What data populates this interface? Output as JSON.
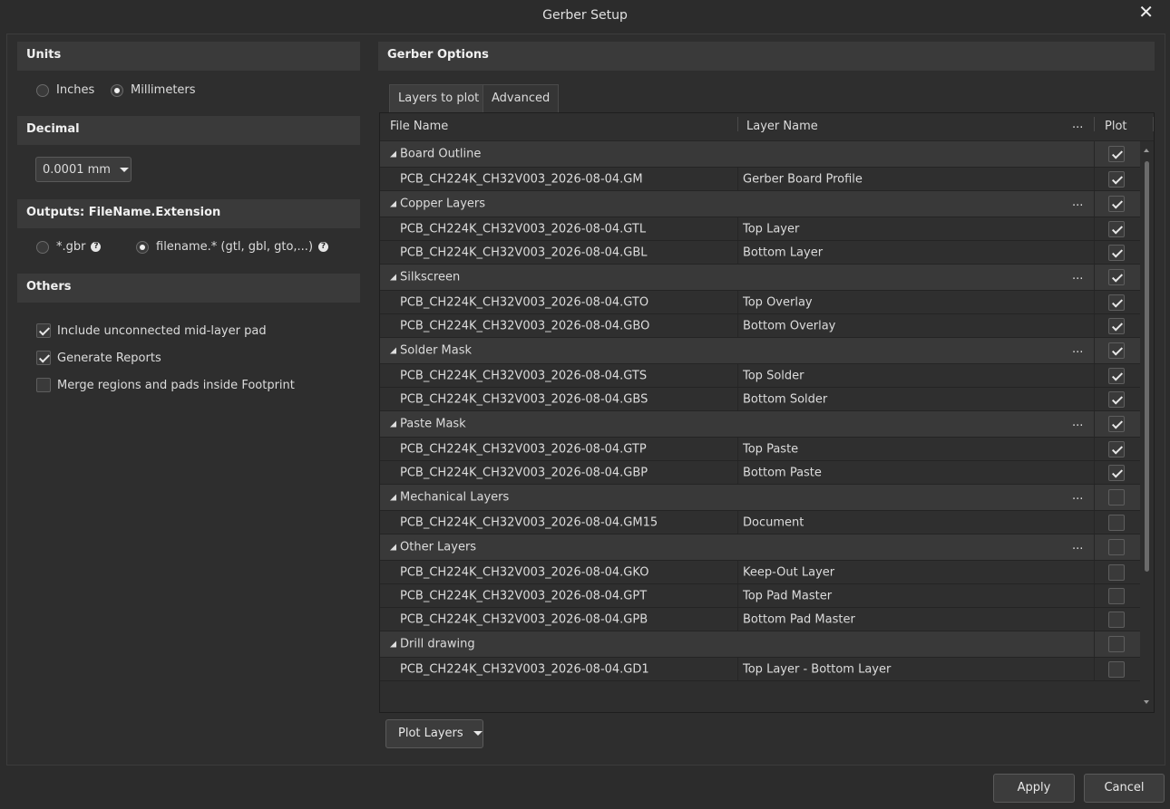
{
  "window": {
    "title": "Gerber Setup"
  },
  "units": {
    "header": "Units",
    "options": [
      "Inches",
      "Millimeters"
    ],
    "selected": "Millimeters"
  },
  "decimal": {
    "header": "Decimal",
    "value": "0.0001 mm"
  },
  "outputs": {
    "header": "Outputs: FileName.Extension",
    "options": [
      "*.gbr",
      "filename.* (gtl, gbl, gto,...)"
    ],
    "selected": "filename.* (gtl, gbl, gto,...)"
  },
  "others": {
    "header": "Others",
    "items": [
      {
        "label": "Include unconnected mid-layer pad",
        "checked": true
      },
      {
        "label": "Generate Reports",
        "checked": true
      },
      {
        "label": "Merge regions and pads inside Footprint",
        "checked": false
      }
    ]
  },
  "gerber_options": {
    "header": "Gerber Options",
    "tabs": [
      "Layers to plot",
      "Advanced"
    ],
    "active_tab": "Layers to plot",
    "columns": {
      "file_name": "File Name",
      "layer_name": "Layer Name",
      "more": "...",
      "plot": "Plot"
    },
    "groups": [
      {
        "name": "Board Outline",
        "dots": "",
        "plot": true,
        "files": [
          {
            "file": "PCB_CH224K_CH32V003_2026-08-04.GM",
            "layer": "Gerber Board Profile",
            "plot": true
          }
        ]
      },
      {
        "name": "Copper Layers",
        "dots": "...",
        "plot": true,
        "files": [
          {
            "file": "PCB_CH224K_CH32V003_2026-08-04.GTL",
            "layer": "Top Layer",
            "plot": true
          },
          {
            "file": "PCB_CH224K_CH32V003_2026-08-04.GBL",
            "layer": "Bottom Layer",
            "plot": true
          }
        ]
      },
      {
        "name": "Silkscreen",
        "dots": "...",
        "plot": true,
        "files": [
          {
            "file": "PCB_CH224K_CH32V003_2026-08-04.GTO",
            "layer": "Top Overlay",
            "plot": true
          },
          {
            "file": "PCB_CH224K_CH32V003_2026-08-04.GBO",
            "layer": "Bottom Overlay",
            "plot": true
          }
        ]
      },
      {
        "name": "Solder Mask",
        "dots": "...",
        "plot": true,
        "files": [
          {
            "file": "PCB_CH224K_CH32V003_2026-08-04.GTS",
            "layer": "Top Solder",
            "plot": true
          },
          {
            "file": "PCB_CH224K_CH32V003_2026-08-04.GBS",
            "layer": "Bottom Solder",
            "plot": true
          }
        ]
      },
      {
        "name": "Paste Mask",
        "dots": "...",
        "plot": true,
        "files": [
          {
            "file": "PCB_CH224K_CH32V003_2026-08-04.GTP",
            "layer": "Top Paste",
            "plot": true
          },
          {
            "file": "PCB_CH224K_CH32V003_2026-08-04.GBP",
            "layer": "Bottom Paste",
            "plot": true
          }
        ]
      },
      {
        "name": "Mechanical Layers",
        "dots": "...",
        "plot": false,
        "files": [
          {
            "file": "PCB_CH224K_CH32V003_2026-08-04.GM15",
            "layer": "Document",
            "plot": false
          }
        ]
      },
      {
        "name": "Other Layers",
        "dots": "...",
        "plot": false,
        "files": [
          {
            "file": "PCB_CH224K_CH32V003_2026-08-04.GKO",
            "layer": "Keep-Out Layer",
            "plot": false
          },
          {
            "file": "PCB_CH224K_CH32V003_2026-08-04.GPT",
            "layer": "Top Pad Master",
            "plot": false
          },
          {
            "file": "PCB_CH224K_CH32V003_2026-08-04.GPB",
            "layer": "Bottom Pad Master",
            "plot": false
          }
        ]
      },
      {
        "name": "Drill drawing",
        "dots": "",
        "plot": false,
        "files": [
          {
            "file": "PCB_CH224K_CH32V003_2026-08-04.GD1",
            "layer": "Top Layer - Bottom Layer",
            "plot": false
          }
        ]
      }
    ],
    "plot_layers_button": "Plot Layers"
  },
  "footer": {
    "apply": "Apply",
    "cancel": "Cancel"
  },
  "icons": {
    "close": "close-icon",
    "dropdown": "chevron-down-icon",
    "help": "help-icon"
  }
}
